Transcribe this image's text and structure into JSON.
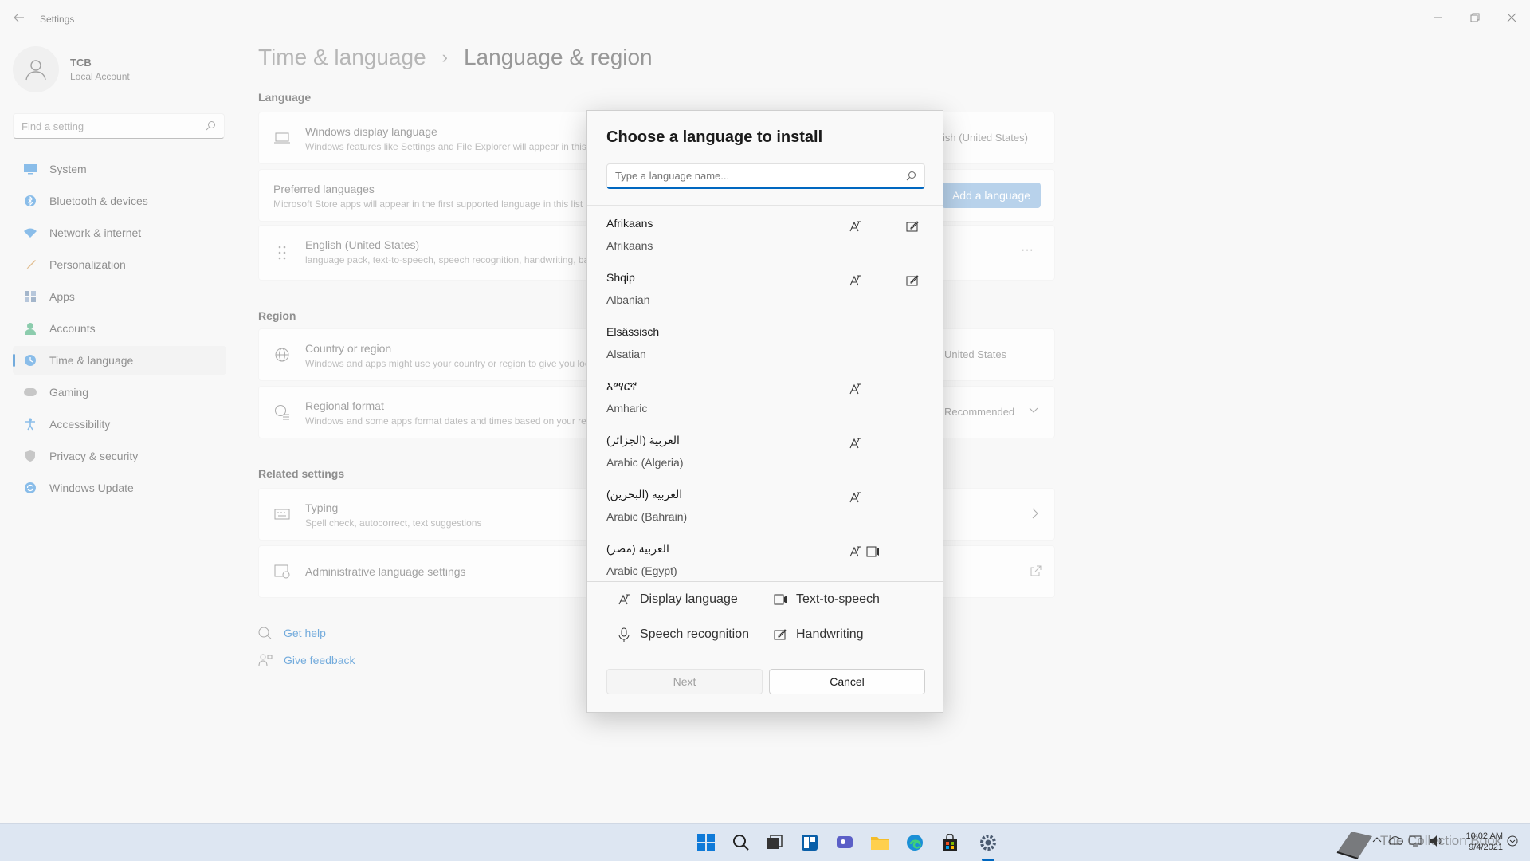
{
  "window": {
    "title": "Settings"
  },
  "profile": {
    "name": "TCB",
    "subtitle": "Local Account"
  },
  "sidebar": {
    "search_placeholder": "Find a setting",
    "items": [
      {
        "label": "System",
        "icon": "monitor-icon",
        "color": "#2b88d8"
      },
      {
        "label": "Bluetooth & devices",
        "icon": "bluetooth-icon",
        "color": "#2b88d8"
      },
      {
        "label": "Network & internet",
        "icon": "wifi-icon",
        "color": "#2b88d8"
      },
      {
        "label": "Personalization",
        "icon": "brush-icon",
        "color": "#c98a3a"
      },
      {
        "label": "Apps",
        "icon": "apps-icon",
        "color": "#5a7aa0"
      },
      {
        "label": "Accounts",
        "icon": "person-icon",
        "color": "#2fa36b"
      },
      {
        "label": "Time & language",
        "icon": "globe-clock-icon",
        "color": "#2b88d8"
      },
      {
        "label": "Gaming",
        "icon": "gamepad-icon",
        "color": "#888888"
      },
      {
        "label": "Accessibility",
        "icon": "accessibility-icon",
        "color": "#2b88d8"
      },
      {
        "label": "Privacy & security",
        "icon": "shield-icon",
        "color": "#888888"
      },
      {
        "label": "Windows Update",
        "icon": "update-icon",
        "color": "#2b88d8"
      }
    ],
    "active_index": 6
  },
  "breadcrumb": {
    "parent": "Time & language",
    "separator": "›",
    "current": "Language & region"
  },
  "language_section": {
    "title": "Language",
    "display_language": {
      "title": "Windows display language",
      "subtitle": "Windows features like Settings and File Explorer will appear in this language",
      "value": "English (United States)"
    },
    "preferred": {
      "title": "Preferred languages",
      "subtitle": "Microsoft Store apps will appear in the first supported language in this list",
      "button": "Add a language"
    },
    "english": {
      "title": "English (United States)",
      "subtitle": "language pack, text-to-speech, speech recognition, handwriting, basic typing",
      "more": "···"
    }
  },
  "region_section": {
    "title": "Region",
    "country": {
      "title": "Country or region",
      "subtitle": "Windows and apps might use your country or region to give you local content",
      "value": "United States"
    },
    "format": {
      "title": "Regional format",
      "subtitle": "Windows and some apps format dates and times based on your regional format",
      "value": "Recommended"
    }
  },
  "related_section": {
    "title": "Related settings",
    "typing": {
      "title": "Typing",
      "subtitle": "Spell check, autocorrect, text suggestions"
    },
    "admin": {
      "title": "Administrative language settings"
    }
  },
  "help": {
    "get_help": "Get help",
    "give_feedback": "Give feedback"
  },
  "dialog": {
    "title": "Choose a language to install",
    "search_placeholder": "Type a language name...",
    "languages": [
      {
        "native": "Afrikaans",
        "english": "Afrikaans",
        "display": true,
        "tts": false,
        "handwriting": true
      },
      {
        "native": "Shqip",
        "english": "Albanian",
        "display": true,
        "tts": false,
        "handwriting": true
      },
      {
        "native": "Elsässisch",
        "english": "Alsatian",
        "display": false,
        "tts": false,
        "handwriting": false
      },
      {
        "native": "አማርኛ",
        "english": "Amharic",
        "display": true,
        "tts": false,
        "handwriting": false
      },
      {
        "native": "العربية (الجزائر)",
        "english": "Arabic (Algeria)",
        "display": true,
        "tts": false,
        "handwriting": false
      },
      {
        "native": "العربية (البحرين)",
        "english": "Arabic (Bahrain)",
        "display": true,
        "tts": false,
        "handwriting": false
      },
      {
        "native": "العربية (مصر)",
        "english": "Arabic (Egypt)",
        "display": true,
        "tts": true,
        "handwriting": false
      }
    ],
    "legend": {
      "display_language": "Display language",
      "text_to_speech": "Text-to-speech",
      "speech_recognition": "Speech recognition",
      "handwriting": "Handwriting"
    },
    "next": "Next",
    "cancel": "Cancel"
  },
  "taskbar": {
    "clock_time": "10:02 AM",
    "clock_date": "9/4/2021",
    "watermark": "The Collection Book"
  },
  "colors": {
    "accent": "#0067c0",
    "button_disabled_accent": "#7fadda"
  }
}
